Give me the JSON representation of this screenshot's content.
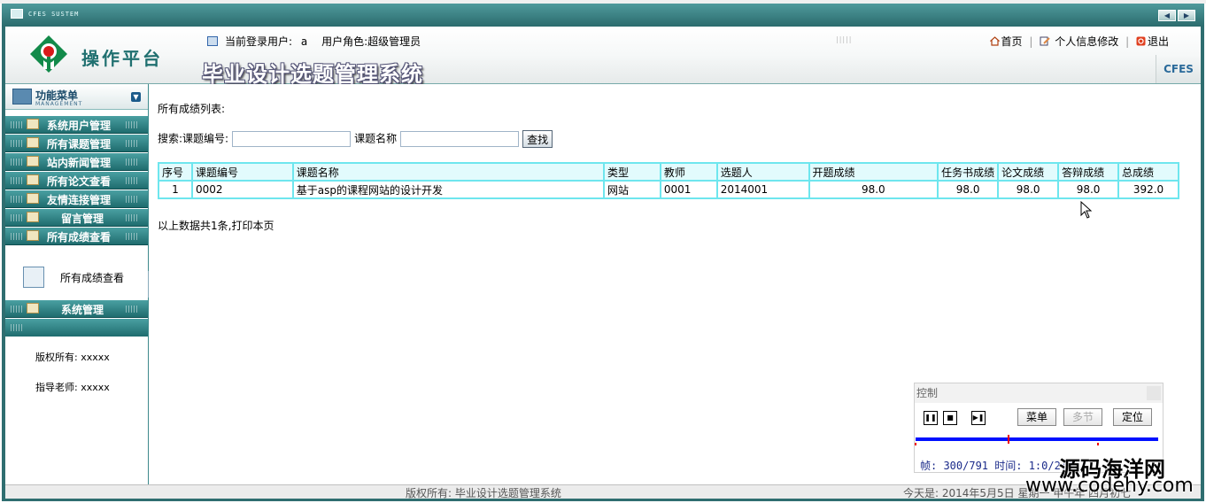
{
  "window": {
    "system_title": "CFES SUSTEM"
  },
  "header": {
    "platform_name": "操作平台",
    "current_user_label": "当前登录用户:",
    "current_user": "a",
    "role_label": "用户角色:",
    "role": "超级管理员",
    "home_link": "首页",
    "profile_link": "个人信息修改",
    "logout_link": "退出",
    "system_name": "毕业设计选题管理系统",
    "brand_tag": "CFES"
  },
  "sidebar": {
    "title": "功能菜单",
    "subtitle": "MANAGEMENT",
    "items": [
      {
        "label": "系统用户管理"
      },
      {
        "label": "所有课题管理"
      },
      {
        "label": "站内新闻管理"
      },
      {
        "label": "所有论文查看"
      },
      {
        "label": "友情连接管理"
      },
      {
        "label": "留言管理"
      },
      {
        "label": "所有成绩查看"
      },
      {
        "label": "系统管理"
      }
    ],
    "active_subitem": "所有成绩查看",
    "copyright": "版权所有: xxxxx",
    "advisor": "指导老师: xxxxx"
  },
  "main": {
    "list_title": "所有成绩列表:",
    "search": {
      "label": "搜索:课题编号:",
      "code_value": "",
      "name_label": "课题名称",
      "name_value": "",
      "button": "查找"
    },
    "table": {
      "headers": [
        "序号",
        "课题编号",
        "课题名称",
        "类型",
        "教师",
        "选题人",
        "开题成绩",
        "任务书成绩",
        "论文成绩",
        "答辩成绩",
        "总成绩"
      ],
      "rows": [
        [
          "1",
          "0002",
          "基于asp的课程网站的设计开发",
          "网站",
          "0001",
          "2014001",
          "98.0",
          "98.0",
          "98.0",
          "98.0",
          "392.0"
        ]
      ]
    },
    "summary": "以上数据共1条,打印本页"
  },
  "statusbar": {
    "copyright": "版权所有: 毕业设计选题管理系统",
    "date": "今天是: 2014年5月5日 星期一 甲午年 四月初七"
  },
  "recorder": {
    "title": "控制",
    "menu_button": "菜单",
    "chapter_button": "多节",
    "locate_button": "定位",
    "status": "帧: 300/791 时间: 1:0/2:4",
    "progress": 0.38
  },
  "watermark": {
    "line1": "源码海洋网",
    "line2": "www.codehy.com"
  }
}
